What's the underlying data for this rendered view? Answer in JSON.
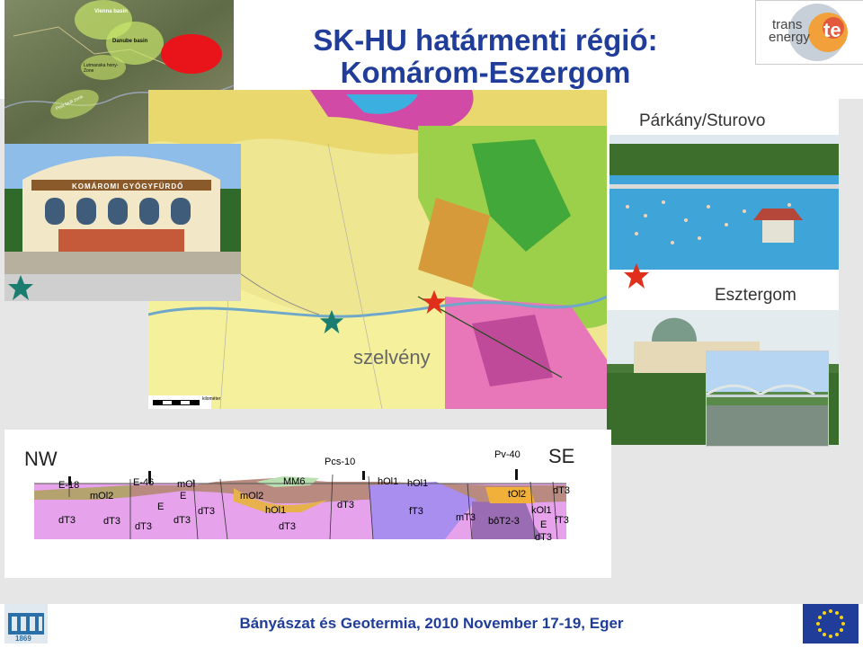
{
  "title": {
    "line1": "SK-HU határmenti régió:",
    "line2": "Komárom-Eszergom"
  },
  "map_overlay_labels": {
    "vienna_basin": "Vienna basin",
    "danube_basin": "Danube basin",
    "zone_a": "Lutmanska hony-Zone",
    "zone_b": "Pest fault zone"
  },
  "photos": {
    "building_sign": "KOMÁROMI GYÓGYFÜRDŐ",
    "parkany_label": "Párkány/Sturovo",
    "esztergom_label": "Esztergom"
  },
  "geomap": {
    "profile_label": "szelvény",
    "scale_label": "kilométer"
  },
  "cross_section": {
    "nw_label": "NW",
    "se_label": "SE",
    "wells": [
      "E-18",
      "E-46",
      "Pcs-10",
      "Pv-40"
    ],
    "units": [
      "mOl2",
      "dT3",
      "dT3",
      "dT3",
      "E",
      "E",
      "mOl",
      "dT3",
      "mOl2",
      "MM6",
      "hOl1",
      "dT3",
      "dT3",
      "dT3",
      "hOl1",
      "hOl1",
      "fT3",
      "mT3",
      "tOl2",
      "dT3",
      "kOl1",
      "bôT2-3",
      "E",
      "fT3",
      "dT3"
    ]
  },
  "logo": {
    "line1": "trans",
    "line2": "energy",
    "mark": "te"
  },
  "footer": {
    "text": "Bányászat és Geotermia, 2010 November 17-19, Eger",
    "year": "1869"
  },
  "colors": {
    "title_blue": "#1f3d99",
    "star_red": "#e0301c",
    "star_teal": "#1b7d70"
  }
}
